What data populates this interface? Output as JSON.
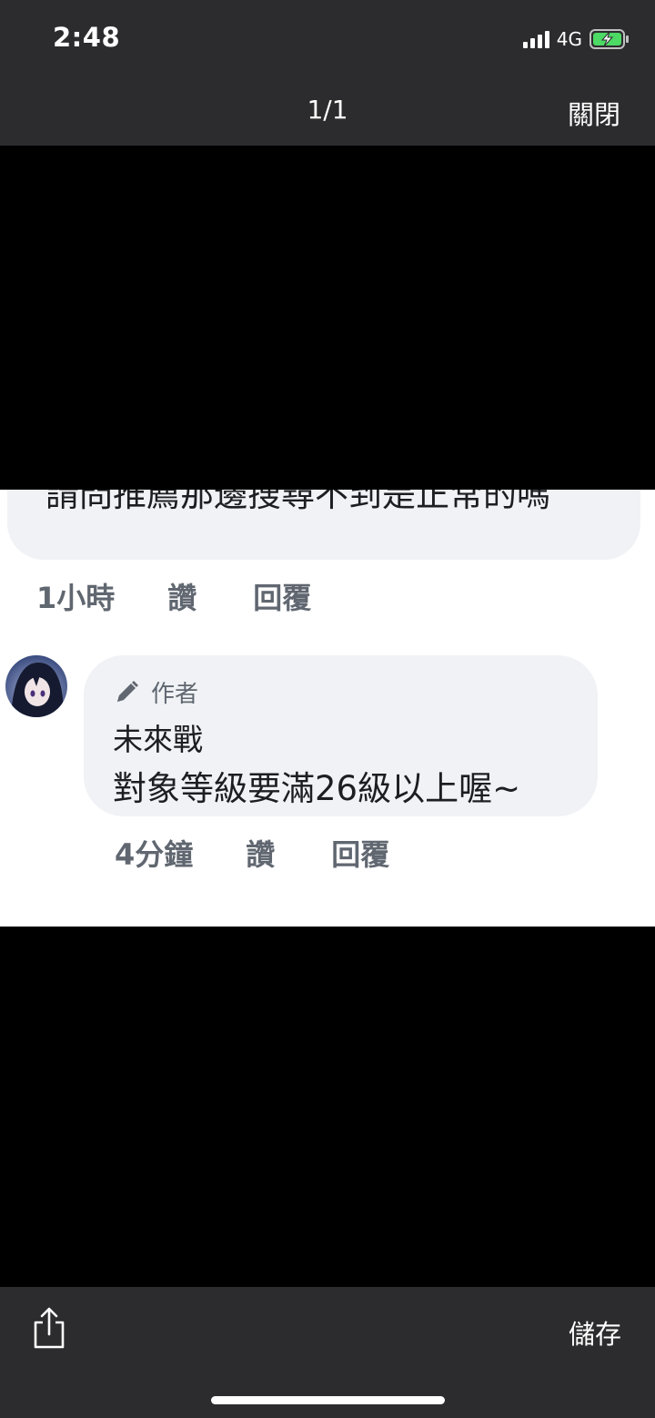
{
  "status_bar": {
    "time": "2:48",
    "network": "4G",
    "signal_bars": 4,
    "battery_state": "charging",
    "battery_color": "#4cd964"
  },
  "viewer": {
    "counter": "1/1",
    "close_label": "關閉",
    "save_label": "儲存",
    "share_icon": "share-icon"
  },
  "image": {
    "previous_comment": {
      "text": "請問推薦那邊搜尋不到是正常的嗎",
      "time": "1小時",
      "like_label": "讚",
      "reply_label": "回覆"
    },
    "reply": {
      "author_badge": "作者",
      "author_badge_icon": "pencil-icon",
      "name": "未來戰",
      "text": "對象等級要滿26級以上喔~",
      "time": "4分鐘",
      "like_label": "讚",
      "reply_label": "回覆"
    }
  }
}
